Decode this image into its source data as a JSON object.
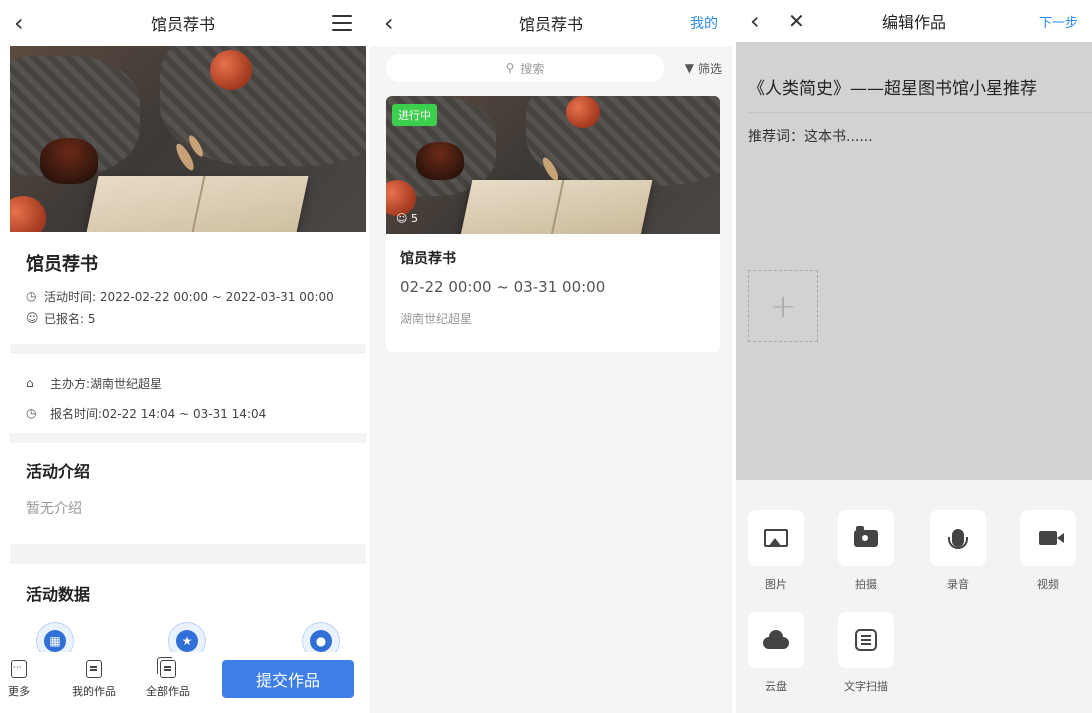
{
  "screen1": {
    "nav": {
      "back_icon": "chevron-left-icon",
      "title": "馆员荐书",
      "menu_icon": "menu-icon"
    },
    "activity": {
      "title": "馆员荐书",
      "time": "活动时间: 2022-02-22 00:00 ~ 2022-03-31 00:00",
      "signed_up": "已报名: 5"
    },
    "organizer": {
      "host": "主办方:湖南世纪超星",
      "signup_time": "报名时间:02-22 14:04 ~ 03-31 14:04"
    },
    "intro": {
      "heading": "活动介绍",
      "content": "暂无介绍"
    },
    "data_section": {
      "heading": "活动数据",
      "icons": [
        "report-icon",
        "star-icon",
        "user-icon"
      ]
    },
    "bottom_bar": {
      "tabs": [
        {
          "label": "更多",
          "icon": "more-icon"
        },
        {
          "label": "我的作品",
          "icon": "document-icon"
        },
        {
          "label": "全部作品",
          "icon": "documents-icon"
        }
      ],
      "submit_label": "提交作品"
    }
  },
  "screen2": {
    "nav": {
      "back_icon": "chevron-left-icon",
      "title": "馆员荐书",
      "right_label": "我的"
    },
    "search": {
      "placeholder": "搜索",
      "filter_label": "筛选"
    },
    "card": {
      "badge": "进行中",
      "count": "5",
      "title": "馆员荐书",
      "time": "02-22 00:00 ~ 03-31 00:00",
      "org": "湖南世纪超星"
    }
  },
  "screen3": {
    "nav": {
      "back_icon": "chevron-left-icon",
      "close_icon": "close-icon",
      "title": "编辑作品",
      "next_label": "下一步"
    },
    "editor": {
      "title": "《人类简史》——超星图书馆小星推荐",
      "body": "推荐词：这本书......",
      "add_icon": "plus-icon"
    },
    "tools": [
      {
        "label": "图片",
        "icon": "image-icon"
      },
      {
        "label": "拍摄",
        "icon": "camera-icon"
      },
      {
        "label": "录音",
        "icon": "microphone-icon"
      },
      {
        "label": "视频",
        "icon": "video-icon"
      },
      {
        "label": "云盘",
        "icon": "cloud-icon"
      },
      {
        "label": "文字扫描",
        "icon": "scan-icon"
      }
    ]
  },
  "colors": {
    "accent": "#3d7fe6",
    "link": "#2d8cf0",
    "badge": "#3ccf4e",
    "editor_bg": "#d2d2d2",
    "divider": "#f2f3f5"
  }
}
